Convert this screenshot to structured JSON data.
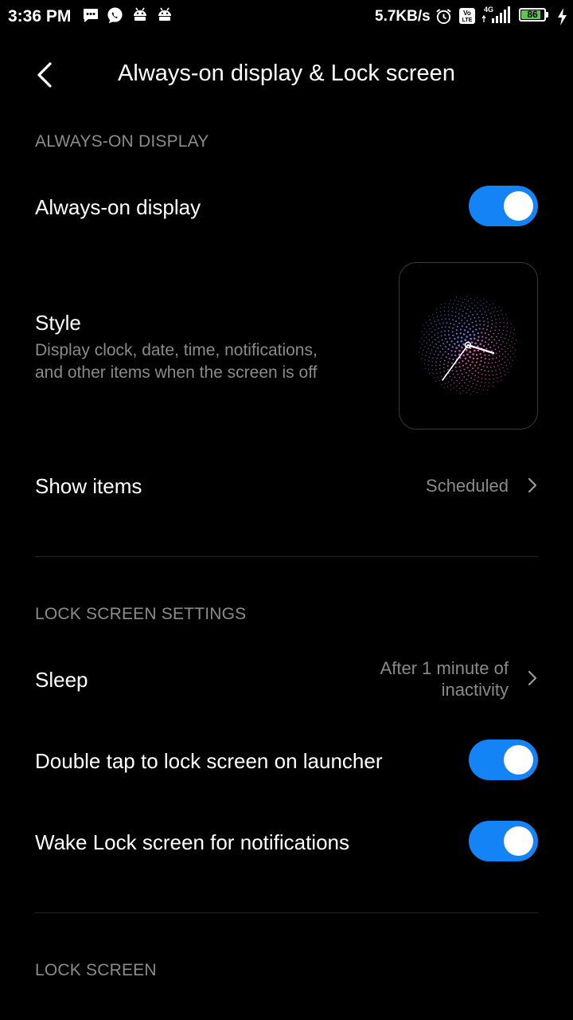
{
  "status_bar": {
    "time": "3:36 PM",
    "net_speed": "5.7KB/s",
    "battery_level": "86",
    "battery_fraction": 0.86,
    "icons": [
      "sms-icon",
      "whatsapp-icon",
      "android-icon",
      "android-icon",
      "alarm-icon",
      "volte-icon",
      "signal-4g-icon",
      "battery-icon",
      "charging-icon"
    ]
  },
  "header": {
    "title": "Always-on display & Lock screen"
  },
  "sections": {
    "aod": {
      "header": "ALWAYS-ON DISPLAY",
      "aod_toggle": {
        "label": "Always-on display",
        "on": true
      },
      "style": {
        "label": "Style",
        "description_line1": "Display clock, date, time, notifications,",
        "description_line2": "and other items when the screen is off"
      },
      "show_items": {
        "label": "Show items",
        "value": "Scheduled"
      }
    },
    "lock_settings": {
      "header": "LOCK SCREEN SETTINGS",
      "sleep": {
        "label": "Sleep",
        "value_line1": "After 1 minute of",
        "value_line2": "inactivity"
      },
      "double_tap": {
        "label": "Double tap to lock screen on launcher",
        "on": true
      },
      "wake_lock": {
        "label": "Wake Lock screen for notifications",
        "on": true
      }
    },
    "lock_screen": {
      "header": "LOCK SCREEN"
    }
  },
  "colors": {
    "background": "#000000",
    "toggle_on": "#1383f5",
    "secondary_text": "#8a8a8a",
    "battery": "#58c94a"
  }
}
